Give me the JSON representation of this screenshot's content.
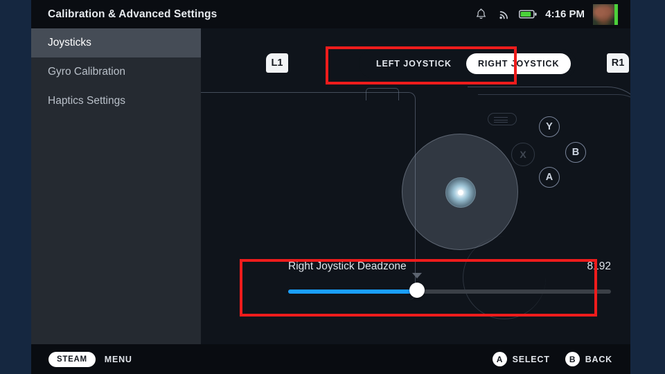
{
  "window": {
    "title": "Calibration & Advanced Settings"
  },
  "status_tray": {
    "notification_icon": "bell-icon",
    "wifi_icon": "wifi-icon",
    "battery_icon": "battery-icon",
    "time": "4:16 PM",
    "avatar": "user-avatar"
  },
  "sidebar": {
    "items": [
      {
        "label": "Joysticks",
        "active": true
      },
      {
        "label": "Gyro Calibration",
        "active": false
      },
      {
        "label": "Haptics Settings",
        "active": false
      }
    ]
  },
  "main": {
    "bumpers": {
      "left": "L1",
      "right": "R1"
    },
    "selector": {
      "options": [
        {
          "label": "LEFT JOYSTICK",
          "selected": false
        },
        {
          "label": "RIGHT JOYSTICK",
          "selected": true
        }
      ]
    },
    "controller": {
      "face_buttons": [
        "Y",
        "B",
        "A"
      ],
      "hidden_button": "X",
      "stick_indicator": "right-stick-position-dot"
    },
    "deadzone": {
      "label": "Right Joystick Deadzone",
      "value": "8192",
      "fill_percent": 40
    }
  },
  "bottom_bar": {
    "steam_label": "STEAM",
    "menu_label": "MENU",
    "hints": [
      {
        "button": "A",
        "label": "SELECT"
      },
      {
        "button": "B",
        "label": "BACK"
      }
    ]
  },
  "annotations": {
    "box_color": "#ee1c1c",
    "boxes": [
      "joystick-selector",
      "deadzone-slider"
    ]
  },
  "colors": {
    "accent_blue": "#1a9fff",
    "sidebar_active": "#454c56",
    "battery_green": "#4bd13a"
  }
}
